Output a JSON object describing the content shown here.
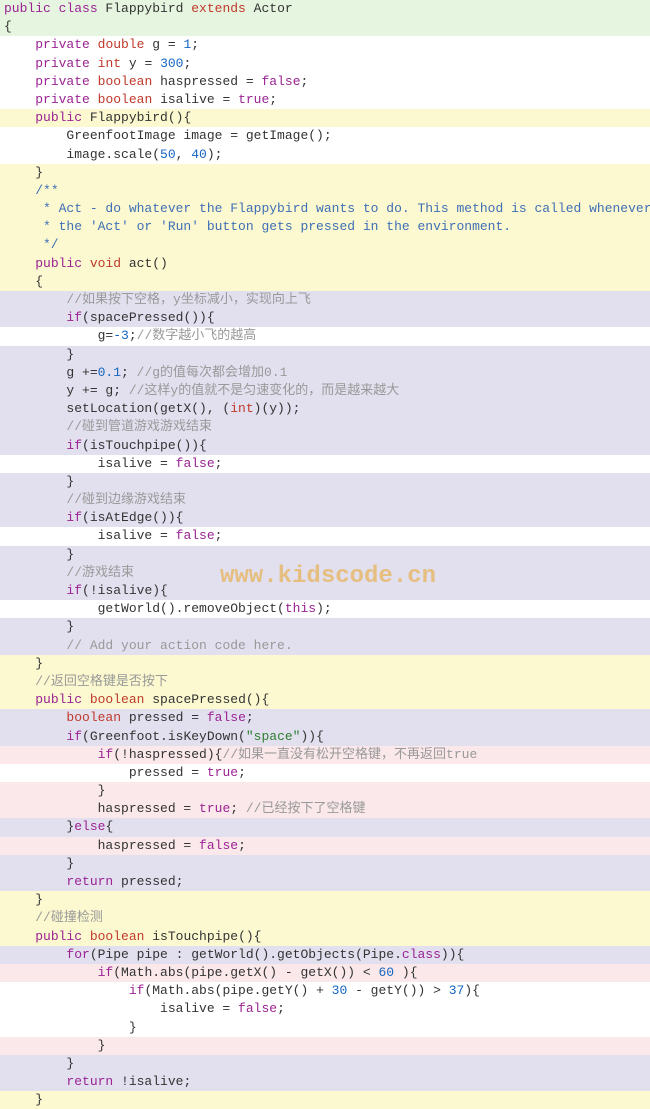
{
  "watermark": "www.kidscode.cn",
  "lines": [
    {
      "bg": "bg-green",
      "segs": [
        {
          "t": "public ",
          "c": "kw"
        },
        {
          "t": "class ",
          "c": "kw"
        },
        {
          "t": "Flappybird ",
          "c": "ident"
        },
        {
          "t": "extends ",
          "c": "kw-red"
        },
        {
          "t": "Actor",
          "c": "ident"
        }
      ]
    },
    {
      "bg": "bg-green",
      "segs": [
        {
          "t": "{",
          "c": "ident"
        }
      ]
    },
    {
      "bg": "bg-white",
      "segs": [
        {
          "t": "    ",
          "c": ""
        },
        {
          "t": "private ",
          "c": "kw"
        },
        {
          "t": "double ",
          "c": "kw-red"
        },
        {
          "t": "g = ",
          "c": "ident"
        },
        {
          "t": "1",
          "c": "num"
        },
        {
          "t": ";",
          "c": "ident"
        }
      ]
    },
    {
      "bg": "bg-white",
      "segs": [
        {
          "t": "    ",
          "c": ""
        },
        {
          "t": "private ",
          "c": "kw"
        },
        {
          "t": "int ",
          "c": "kw-red"
        },
        {
          "t": "y = ",
          "c": "ident"
        },
        {
          "t": "300",
          "c": "num"
        },
        {
          "t": ";",
          "c": "ident"
        }
      ]
    },
    {
      "bg": "bg-white",
      "segs": [
        {
          "t": "    ",
          "c": ""
        },
        {
          "t": "private ",
          "c": "kw"
        },
        {
          "t": "boolean ",
          "c": "kw-red"
        },
        {
          "t": "haspressed = ",
          "c": "ident"
        },
        {
          "t": "false",
          "c": "kw-bool"
        },
        {
          "t": ";",
          "c": "ident"
        }
      ]
    },
    {
      "bg": "bg-white",
      "segs": [
        {
          "t": "    ",
          "c": ""
        },
        {
          "t": "private ",
          "c": "kw"
        },
        {
          "t": "boolean ",
          "c": "kw-red"
        },
        {
          "t": "isalive = ",
          "c": "ident"
        },
        {
          "t": "true",
          "c": "kw-bool"
        },
        {
          "t": ";",
          "c": "ident"
        }
      ]
    },
    {
      "bg": "bg-yellow",
      "segs": [
        {
          "t": "    ",
          "c": ""
        },
        {
          "t": "public ",
          "c": "kw"
        },
        {
          "t": "Flappybird(){",
          "c": "ident"
        }
      ]
    },
    {
      "bg": "bg-white",
      "segs": [
        {
          "t": "        GreenfootImage image = getImage();",
          "c": "ident"
        }
      ]
    },
    {
      "bg": "bg-white",
      "segs": [
        {
          "t": "        image.scale(",
          "c": "ident"
        },
        {
          "t": "50",
          "c": "num"
        },
        {
          "t": ", ",
          "c": "ident"
        },
        {
          "t": "40",
          "c": "num"
        },
        {
          "t": ");",
          "c": "ident"
        }
      ]
    },
    {
      "bg": "bg-yellow",
      "segs": [
        {
          "t": "    }",
          "c": "ident"
        }
      ]
    },
    {
      "bg": "bg-yellow",
      "segs": [
        {
          "t": "    ",
          "c": ""
        },
        {
          "t": "/**",
          "c": "comment-blue"
        }
      ]
    },
    {
      "bg": "bg-yellow",
      "segs": [
        {
          "t": "     * Act - do whatever the Flappybird wants to do. This method is called whenever",
          "c": "comment-blue"
        }
      ]
    },
    {
      "bg": "bg-yellow",
      "segs": [
        {
          "t": "     * the 'Act' or 'Run' button gets pressed in the environment.",
          "c": "comment-blue"
        }
      ]
    },
    {
      "bg": "bg-yellow",
      "segs": [
        {
          "t": "     */",
          "c": "comment-blue"
        }
      ]
    },
    {
      "bg": "bg-yellow",
      "segs": [
        {
          "t": "    ",
          "c": ""
        },
        {
          "t": "public ",
          "c": "kw"
        },
        {
          "t": "void ",
          "c": "kw-red"
        },
        {
          "t": "act()",
          "c": "ident"
        }
      ]
    },
    {
      "bg": "bg-yellow",
      "segs": [
        {
          "t": "    {",
          "c": "ident"
        }
      ]
    },
    {
      "bg": "bg-lavender",
      "segs": [
        {
          "t": "        ",
          "c": ""
        },
        {
          "t": "//如果按下空格，y坐标减小，实现向上飞",
          "c": "comment"
        }
      ]
    },
    {
      "bg": "bg-lavender",
      "segs": [
        {
          "t": "        ",
          "c": ""
        },
        {
          "t": "if",
          "c": "kw-ctrl"
        },
        {
          "t": "(spacePressed()){",
          "c": "ident"
        }
      ]
    },
    {
      "bg": "bg-white",
      "segs": [
        {
          "t": "            g=",
          "c": "ident"
        },
        {
          "t": "-3",
          "c": "num"
        },
        {
          "t": ";",
          "c": "ident"
        },
        {
          "t": "//数字越小飞的越高",
          "c": "comment"
        }
      ]
    },
    {
      "bg": "bg-lavender",
      "segs": [
        {
          "t": "        }",
          "c": "ident"
        }
      ]
    },
    {
      "bg": "bg-lavender",
      "segs": [
        {
          "t": "        g +=",
          "c": "ident"
        },
        {
          "t": "0.1",
          "c": "num"
        },
        {
          "t": "; ",
          "c": "ident"
        },
        {
          "t": "//g的值每次都会增加0.1",
          "c": "comment"
        }
      ]
    },
    {
      "bg": "bg-lavender",
      "segs": [
        {
          "t": "        y += g; ",
          "c": "ident"
        },
        {
          "t": "//这样y的值就不是匀速变化的，而是越来越大",
          "c": "comment"
        }
      ]
    },
    {
      "bg": "bg-lavender",
      "segs": [
        {
          "t": "        setLocation(getX(), (",
          "c": "ident"
        },
        {
          "t": "int",
          "c": "kw-red"
        },
        {
          "t": ")(y));",
          "c": "ident"
        }
      ]
    },
    {
      "bg": "bg-lavender",
      "segs": [
        {
          "t": "        ",
          "c": ""
        },
        {
          "t": "//碰到管道游戏游戏结束",
          "c": "comment"
        }
      ]
    },
    {
      "bg": "bg-lavender",
      "segs": [
        {
          "t": "        ",
          "c": ""
        },
        {
          "t": "if",
          "c": "kw-ctrl"
        },
        {
          "t": "(isTouchpipe()){",
          "c": "ident"
        }
      ]
    },
    {
      "bg": "bg-white",
      "segs": [
        {
          "t": "            isalive = ",
          "c": "ident"
        },
        {
          "t": "false",
          "c": "kw-bool"
        },
        {
          "t": ";",
          "c": "ident"
        }
      ]
    },
    {
      "bg": "bg-lavender",
      "segs": [
        {
          "t": "        }",
          "c": "ident"
        }
      ]
    },
    {
      "bg": "bg-lavender",
      "segs": [
        {
          "t": "        ",
          "c": ""
        },
        {
          "t": "//碰到边缘游戏结束",
          "c": "comment"
        }
      ]
    },
    {
      "bg": "bg-lavender",
      "segs": [
        {
          "t": "        ",
          "c": ""
        },
        {
          "t": "if",
          "c": "kw-ctrl"
        },
        {
          "t": "(isAtEdge()){",
          "c": "ident"
        }
      ]
    },
    {
      "bg": "bg-white",
      "segs": [
        {
          "t": "            isalive = ",
          "c": "ident"
        },
        {
          "t": "false",
          "c": "kw-bool"
        },
        {
          "t": ";",
          "c": "ident"
        }
      ]
    },
    {
      "bg": "bg-lavender",
      "segs": [
        {
          "t": "        }",
          "c": "ident"
        }
      ]
    },
    {
      "bg": "bg-lavender",
      "segs": [
        {
          "t": "        ",
          "c": ""
        },
        {
          "t": "//游戏结束",
          "c": "comment"
        }
      ]
    },
    {
      "bg": "bg-lavender",
      "segs": [
        {
          "t": "        ",
          "c": ""
        },
        {
          "t": "if",
          "c": "kw-ctrl"
        },
        {
          "t": "(!isalive){",
          "c": "ident"
        }
      ]
    },
    {
      "bg": "bg-white",
      "segs": [
        {
          "t": "            getWorld().removeObject(",
          "c": "ident"
        },
        {
          "t": "this",
          "c": "kw"
        },
        {
          "t": ");",
          "c": "ident"
        }
      ]
    },
    {
      "bg": "bg-lavender",
      "segs": [
        {
          "t": "        }",
          "c": "ident"
        }
      ]
    },
    {
      "bg": "bg-lavender",
      "segs": [
        {
          "t": "        ",
          "c": ""
        },
        {
          "t": "// Add your action code here.",
          "c": "comment"
        }
      ]
    },
    {
      "bg": "bg-yellow",
      "segs": [
        {
          "t": "    }",
          "c": "ident"
        }
      ]
    },
    {
      "bg": "bg-yellow",
      "segs": [
        {
          "t": "    ",
          "c": ""
        },
        {
          "t": "//返回空格键是否按下",
          "c": "comment"
        }
      ]
    },
    {
      "bg": "bg-yellow",
      "segs": [
        {
          "t": "    ",
          "c": ""
        },
        {
          "t": "public ",
          "c": "kw"
        },
        {
          "t": "boolean ",
          "c": "kw-red"
        },
        {
          "t": "spacePressed(){",
          "c": "ident"
        }
      ]
    },
    {
      "bg": "bg-lavender",
      "segs": [
        {
          "t": "        ",
          "c": ""
        },
        {
          "t": "boolean ",
          "c": "kw-red"
        },
        {
          "t": "pressed = ",
          "c": "ident"
        },
        {
          "t": "false",
          "c": "kw-bool"
        },
        {
          "t": ";",
          "c": "ident"
        }
      ]
    },
    {
      "bg": "bg-lavender",
      "segs": [
        {
          "t": "        ",
          "c": ""
        },
        {
          "t": "if",
          "c": "kw-ctrl"
        },
        {
          "t": "(Greenfoot.isKeyDown(",
          "c": "ident"
        },
        {
          "t": "\"space\"",
          "c": "str"
        },
        {
          "t": ")){",
          "c": "ident"
        }
      ]
    },
    {
      "bg": "bg-pink",
      "segs": [
        {
          "t": "            ",
          "c": ""
        },
        {
          "t": "if",
          "c": "kw-ctrl"
        },
        {
          "t": "(!haspressed){",
          "c": "ident"
        },
        {
          "t": "//如果一直没有松开空格键，不再返回true",
          "c": "comment"
        }
      ]
    },
    {
      "bg": "bg-white",
      "segs": [
        {
          "t": "                pressed = ",
          "c": "ident"
        },
        {
          "t": "true",
          "c": "kw-bool"
        },
        {
          "t": ";",
          "c": "ident"
        }
      ]
    },
    {
      "bg": "bg-pink",
      "segs": [
        {
          "t": "            }",
          "c": "ident"
        }
      ]
    },
    {
      "bg": "bg-pink",
      "segs": [
        {
          "t": "            haspressed = ",
          "c": "ident"
        },
        {
          "t": "true",
          "c": "kw-bool"
        },
        {
          "t": "; ",
          "c": "ident"
        },
        {
          "t": "//已经按下了空格键",
          "c": "comment"
        }
      ]
    },
    {
      "bg": "bg-lavender",
      "segs": [
        {
          "t": "        }",
          "c": "ident"
        },
        {
          "t": "else",
          "c": "kw-ctrl"
        },
        {
          "t": "{",
          "c": "ident"
        }
      ]
    },
    {
      "bg": "bg-pink",
      "segs": [
        {
          "t": "            haspressed = ",
          "c": "ident"
        },
        {
          "t": "false",
          "c": "kw-bool"
        },
        {
          "t": ";",
          "c": "ident"
        }
      ]
    },
    {
      "bg": "bg-lavender",
      "segs": [
        {
          "t": "        }",
          "c": "ident"
        }
      ]
    },
    {
      "bg": "bg-lavender",
      "segs": [
        {
          "t": "        ",
          "c": ""
        },
        {
          "t": "return ",
          "c": "kw-ctrl"
        },
        {
          "t": "pressed;",
          "c": "ident"
        }
      ]
    },
    {
      "bg": "bg-yellow",
      "segs": [
        {
          "t": "    }",
          "c": "ident"
        }
      ]
    },
    {
      "bg": "bg-yellow",
      "segs": [
        {
          "t": "    ",
          "c": ""
        },
        {
          "t": "//碰撞检测",
          "c": "comment"
        }
      ]
    },
    {
      "bg": "bg-yellow",
      "segs": [
        {
          "t": "    ",
          "c": ""
        },
        {
          "t": "public ",
          "c": "kw"
        },
        {
          "t": "boolean ",
          "c": "kw-red"
        },
        {
          "t": "isTouchpipe(){",
          "c": "ident"
        }
      ]
    },
    {
      "bg": "bg-lavender",
      "segs": [
        {
          "t": "        ",
          "c": ""
        },
        {
          "t": "for",
          "c": "kw-ctrl"
        },
        {
          "t": "(Pipe pipe : getWorld().getObjects(Pipe.",
          "c": "ident"
        },
        {
          "t": "class",
          "c": "kw"
        },
        {
          "t": ")){",
          "c": "ident"
        }
      ]
    },
    {
      "bg": "bg-pink",
      "segs": [
        {
          "t": "            ",
          "c": ""
        },
        {
          "t": "if",
          "c": "kw-ctrl"
        },
        {
          "t": "(Math.abs(pipe.getX() - getX()) < ",
          "c": "ident"
        },
        {
          "t": "60",
          "c": "num"
        },
        {
          "t": " ){",
          "c": "ident"
        }
      ]
    },
    {
      "bg": "bg-white",
      "segs": [
        {
          "t": "                ",
          "c": ""
        },
        {
          "t": "if",
          "c": "kw-ctrl"
        },
        {
          "t": "(Math.abs(pipe.getY() + ",
          "c": "ident"
        },
        {
          "t": "30",
          "c": "num"
        },
        {
          "t": " - getY()) > ",
          "c": "ident"
        },
        {
          "t": "37",
          "c": "num"
        },
        {
          "t": "){",
          "c": "ident"
        }
      ]
    },
    {
      "bg": "bg-white",
      "segs": [
        {
          "t": "                    isalive = ",
          "c": "ident"
        },
        {
          "t": "false",
          "c": "kw-bool"
        },
        {
          "t": ";",
          "c": "ident"
        }
      ]
    },
    {
      "bg": "bg-white",
      "segs": [
        {
          "t": "                }",
          "c": "ident"
        }
      ]
    },
    {
      "bg": "bg-pink",
      "segs": [
        {
          "t": "            }",
          "c": "ident"
        }
      ]
    },
    {
      "bg": "bg-lavender",
      "segs": [
        {
          "t": "        }",
          "c": "ident"
        }
      ]
    },
    {
      "bg": "bg-lavender",
      "segs": [
        {
          "t": "        ",
          "c": ""
        },
        {
          "t": "return ",
          "c": "kw-ctrl"
        },
        {
          "t": "!isalive;",
          "c": "ident"
        }
      ]
    },
    {
      "bg": "bg-yellow",
      "segs": [
        {
          "t": "    }",
          "c": "ident"
        }
      ]
    }
  ]
}
